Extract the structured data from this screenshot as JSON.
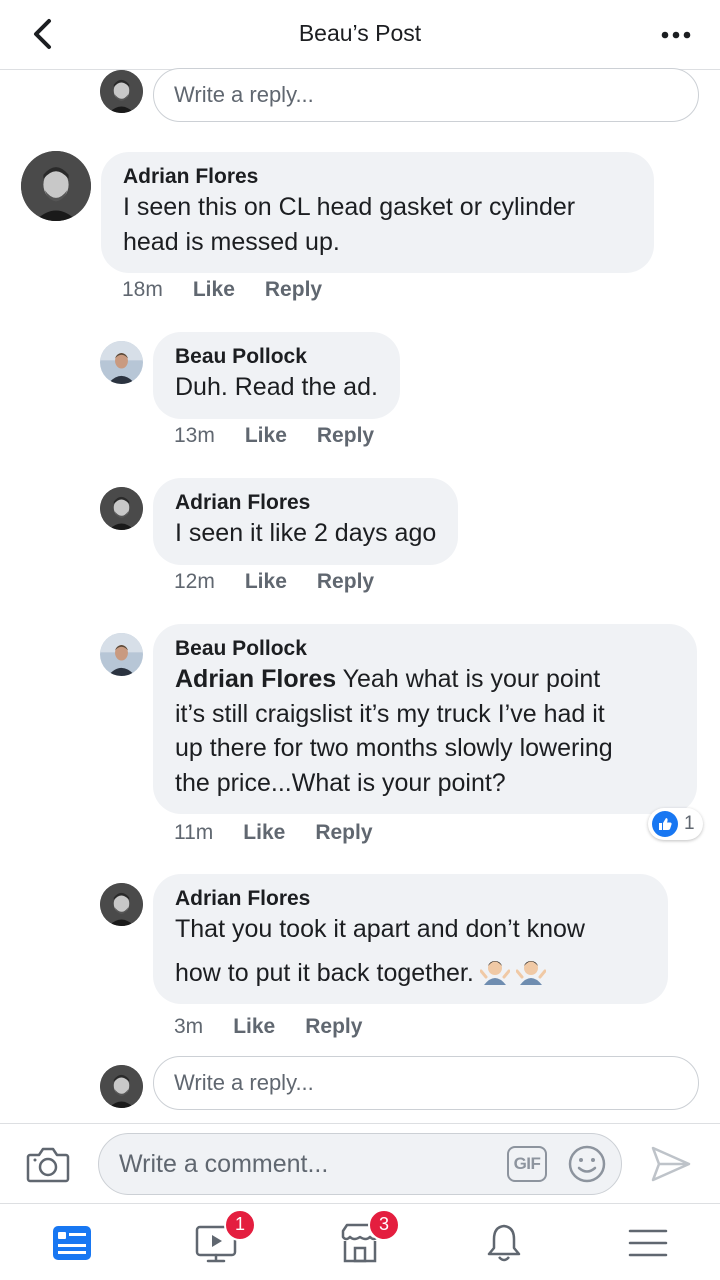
{
  "header": {
    "title": "Beau’s Post",
    "back_icon": "chevron-left-icon",
    "more_icon": "more-horizontal-icon"
  },
  "reply_top": {
    "placeholder": "Write a reply..."
  },
  "comments": [
    {
      "author": "Adrian Flores",
      "lines": [
        "I seen this on CL head gasket or cylinder",
        "head is messed up."
      ],
      "time": "18m",
      "like": "Like",
      "reply": "Reply"
    },
    {
      "author": "Beau Pollock",
      "lines": [
        "Duh. Read the ad."
      ],
      "time": "13m",
      "like": "Like",
      "reply": "Reply"
    },
    {
      "author": "Adrian Flores",
      "lines": [
        "I seen it like 2 days ago"
      ],
      "time": "12m",
      "like": "Like",
      "reply": "Reply"
    },
    {
      "author": "Beau Pollock",
      "mention": "Adrian Flores",
      "lines": [
        " Yeah what is your point",
        "it’s still craigslist it’s my truck I’ve had it",
        "up there for two months slowly lowering",
        "the price...What is your point?"
      ],
      "time": "11m",
      "like": "Like",
      "reply": "Reply",
      "reaction_count": "1"
    },
    {
      "author": "Adrian Flores",
      "lines": [
        "That you took it apart and don’t know",
        "how to put it back together."
      ],
      "emojis": [
        "man-shrugging-emoji",
        "man-shrugging-emoji"
      ],
      "time": "3m",
      "like": "Like",
      "reply": "Reply"
    }
  ],
  "reply_bottom": {
    "placeholder": "Write a reply..."
  },
  "composer": {
    "placeholder": "Write a comment...",
    "gif_label": "GIF",
    "icons": [
      "camera-icon",
      "smiley-icon",
      "send-icon"
    ]
  },
  "tabbar": {
    "tabs": [
      {
        "icon": "news-feed-icon",
        "badge": ""
      },
      {
        "icon": "watch-video-icon",
        "badge": "1"
      },
      {
        "icon": "marketplace-icon",
        "badge": "3"
      },
      {
        "icon": "notifications-bell-icon",
        "badge": ""
      },
      {
        "icon": "menu-icon",
        "badge": ""
      }
    ]
  },
  "colors": {
    "accent": "#1877f2",
    "bubble": "#f0f2f5",
    "muted": "#606770",
    "badge": "#e41e3f"
  }
}
